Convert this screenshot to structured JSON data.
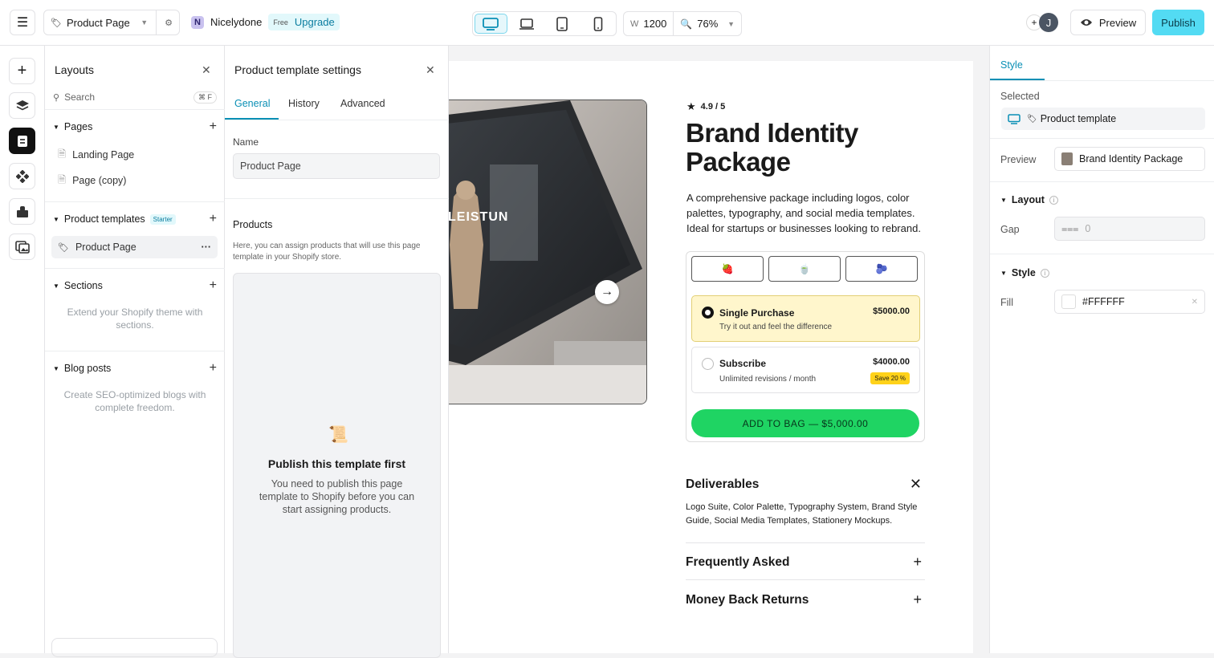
{
  "topbar": {
    "page_select": "Product Page",
    "workspace": "Nicelydone",
    "workspace_initial": "N",
    "plan": "Free",
    "upgrade": "Upgrade",
    "width_label": "W",
    "width_value": "1200",
    "zoom": "76%",
    "avatar_initial": "J",
    "preview": "Preview",
    "publish": "Publish"
  },
  "layouts": {
    "title": "Layouts",
    "search_placeholder": "Search",
    "shortcut": "⌘ F",
    "pages_title": "Pages",
    "pages": [
      "Landing Page",
      "Page (copy)"
    ],
    "templates_title": "Product templates",
    "templates_badge": "Starter",
    "templates": [
      "Product Page"
    ],
    "sections_title": "Sections",
    "sections_empty": "Extend your Shopify theme with sections.",
    "blog_title": "Blog posts",
    "blog_empty": "Create SEO-optimized blogs with complete freedom."
  },
  "settings": {
    "title": "Product template settings",
    "tabs": [
      "General",
      "History",
      "Advanced"
    ],
    "name_label": "Name",
    "name_value": "Product Page",
    "products_title": "Products",
    "products_desc": "Here, you can assign products that will use this page template in your Shopify store.",
    "empty_title": "Publish this template first",
    "empty_desc": "You need to publish this page template to Shopify before you can start assigning products."
  },
  "product": {
    "rating": "4.9 / 5",
    "title": "Brand Identity Package",
    "description": "A comprehensive package including logos, color palettes, typography, and social media templates. Ideal for startups or businesses looking to rebrand.",
    "hero_text": "LEISTUN",
    "variants": [
      "🍓",
      "🍵",
      "🫐"
    ],
    "single_title": "Single Purchase",
    "single_sub": "Try it out and feel the difference",
    "single_price": "$5000.00",
    "sub_title": "Subscribe",
    "sub_sub": "Unlimited revisions / month",
    "sub_price": "$4000.00",
    "save": "Save 20 %",
    "add_to_bag": "ADD TO BAG  —  $5,000.00",
    "deliverables_title": "Deliverables",
    "deliverables_body": "Logo Suite, Color Palette, Typography System, Brand Style Guide, Social Media Templates, Stationery Mockups.",
    "faq_title": "Frequently Asked",
    "returns_title": "Money Back Returns"
  },
  "rpanel": {
    "tab": "Style",
    "selected_label": "Selected",
    "selected_value": "Product template",
    "preview_label": "Preview",
    "preview_value": "Brand Identity Package",
    "layout_title": "Layout",
    "gap_label": "Gap",
    "gap_value": "0",
    "style_title": "Style",
    "fill_label": "Fill",
    "fill_value": "#FFFFFF"
  },
  "colors": {
    "accent": "#0a8fb5",
    "publish": "#53dbf3",
    "add_to_bag": "#1fd463",
    "selected_option": "#fff6cc"
  }
}
